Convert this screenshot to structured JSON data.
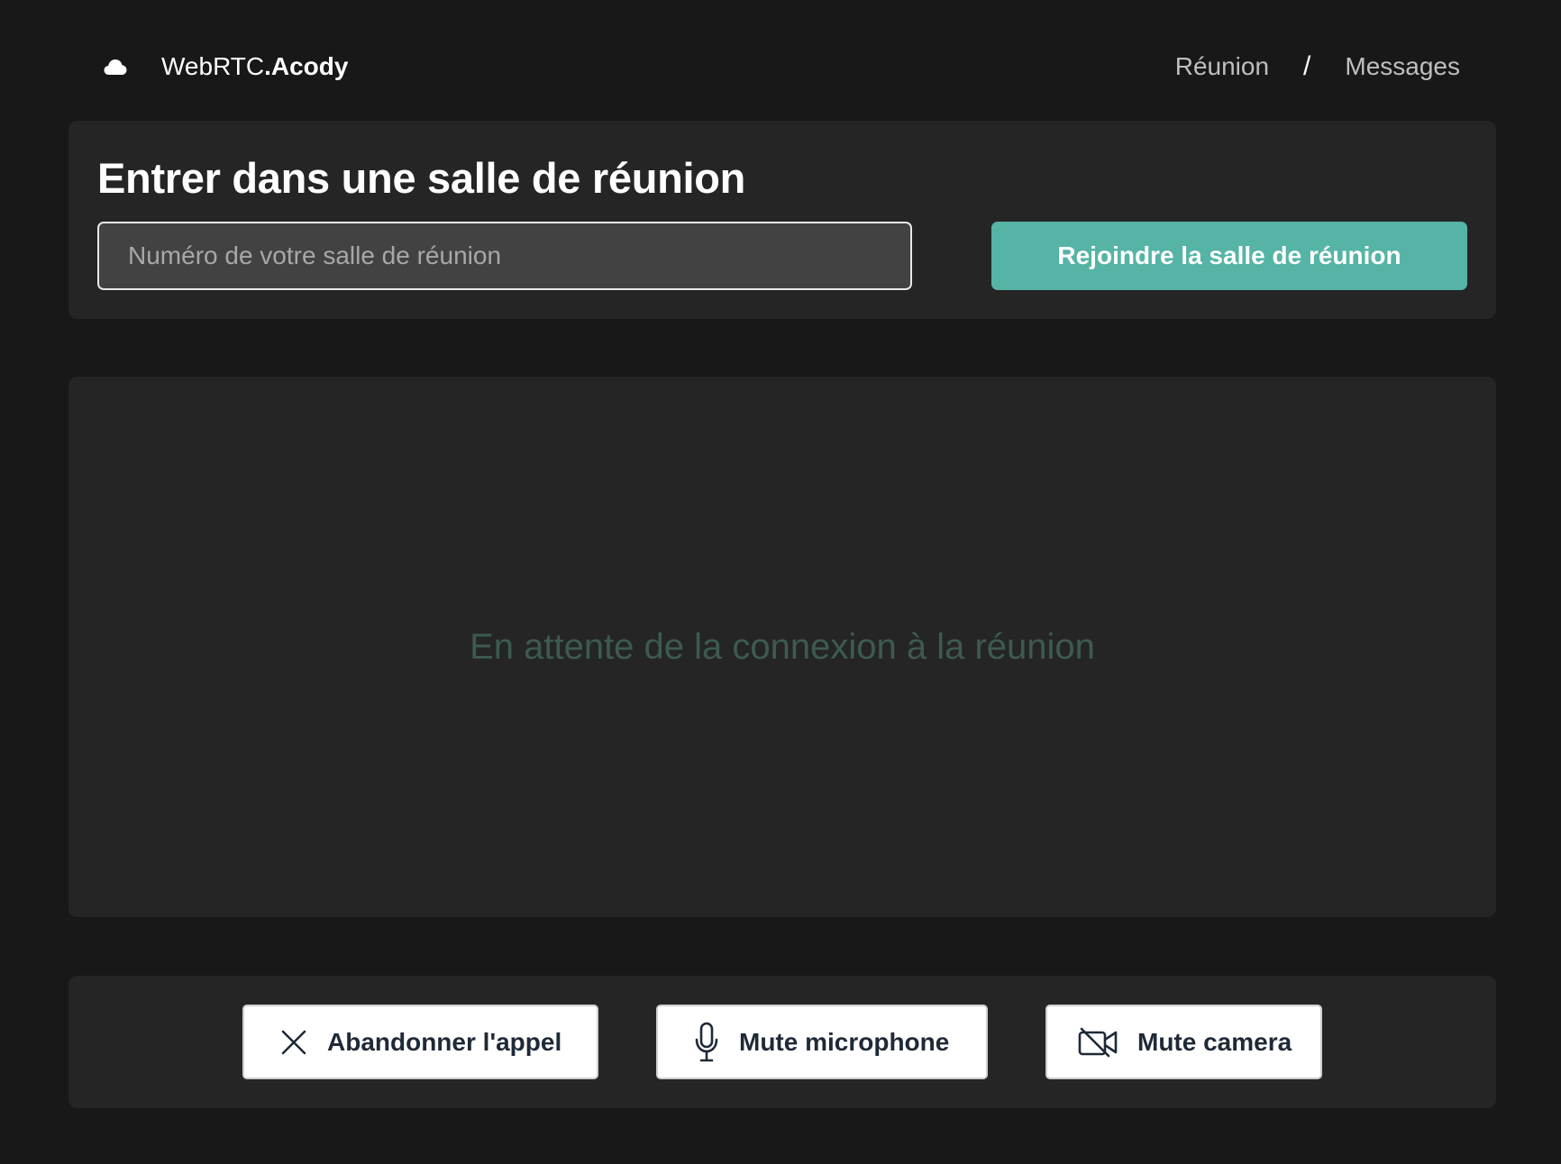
{
  "header": {
    "brand_prefix": "WebRTC",
    "brand_suffix": ".Acody",
    "brand_icon": "cloud-icon",
    "nav": [
      {
        "label": "Réunion"
      },
      {
        "label": "Messages"
      }
    ],
    "separator": "/"
  },
  "join": {
    "title": "Entrer dans une salle de réunion",
    "input_value": "",
    "input_placeholder": "Numéro de votre salle de réunion",
    "button_label": "Rejoindre la salle de réunion"
  },
  "video": {
    "status_text": "En attente de la connexion à la réunion"
  },
  "controls": {
    "leave_label": "Abandonner l'appel",
    "leave_icon": "close-icon",
    "mic_label": "Mute microphone",
    "mic_icon": "microphone-icon",
    "cam_label": "Mute camera",
    "cam_icon": "camera-off-icon"
  },
  "colors": {
    "background": "#181818",
    "panel": "#252525",
    "accent": "#55b4a5",
    "status_text": "#3d5a52"
  }
}
